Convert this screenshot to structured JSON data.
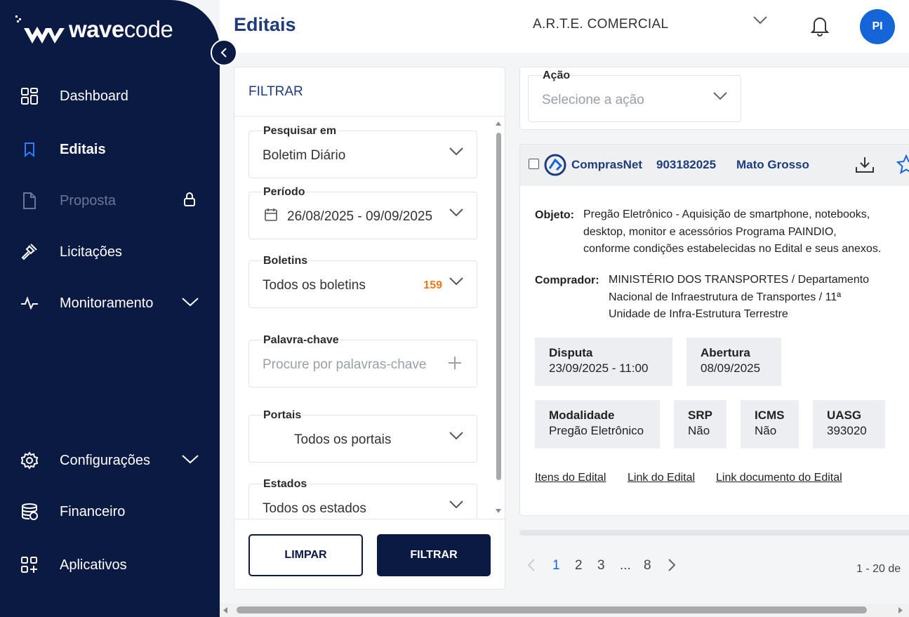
{
  "brand": {
    "name_bold": "wave",
    "name_light": "code"
  },
  "sidebar": {
    "items": [
      {
        "label": "Dashboard",
        "icon": "dashboard-grid-icon"
      },
      {
        "label": "Editais",
        "icon": "bookmark-icon"
      },
      {
        "label": "Proposta",
        "icon": "document-icon"
      },
      {
        "label": "Licitações",
        "icon": "gavel-icon"
      },
      {
        "label": "Monitoramento",
        "icon": "pulse-icon"
      },
      {
        "label": "Configurações",
        "icon": "gear-icon"
      },
      {
        "label": "Financeiro",
        "icon": "coins-stack-icon"
      },
      {
        "label": "Aplicativos",
        "icon": "apps-plus-icon"
      }
    ]
  },
  "header": {
    "title": "Editais",
    "company": "A.R.T.E. COMERCIAL",
    "avatar_initials": "PI"
  },
  "filter": {
    "title": "FILTRAR",
    "fields": {
      "pesquisar_em": {
        "label": "Pesquisar em",
        "value": "Boletim Diário"
      },
      "periodo": {
        "label": "Período",
        "value": "26/08/2025 - 09/09/2025"
      },
      "boletins": {
        "label": "Boletins",
        "value": "Todos os boletins",
        "count": "159"
      },
      "palavra_chave": {
        "label": "Palavra-chave",
        "placeholder": "Procure por palavras-chave"
      },
      "portais": {
        "label": "Portais",
        "value": "Todos os portais"
      },
      "estados": {
        "label": "Estados",
        "value": "Todos os estados"
      }
    },
    "clear_label": "LIMPAR",
    "submit_label": "FILTRAR"
  },
  "action": {
    "label": "Ação",
    "placeholder": "Selecione a ação"
  },
  "result": {
    "portal": "ComprasNet",
    "number": "903182025",
    "state": "Mato Grosso",
    "objeto_label": "Objeto:",
    "objeto_lines": [
      "Pregão Eletrônico - Aquisição de smartphone, notebooks,",
      "desktop, monitor e acessórios Programa PAINDIO,",
      "conforme condições estabelecidas no Edital e seus anexos."
    ],
    "comprador_label": "Comprador:",
    "comprador_lines": [
      "MINISTÉRIO DOS TRANSPORTES / Departamento",
      "Nacional de Infraestrutura de Transportes / 11ª",
      "Unidade de Infra-Estrutura Terrestre"
    ],
    "disputa": {
      "label": "Disputa",
      "value": "23/09/2025 - 11:00"
    },
    "abertura": {
      "label": "Abertura",
      "value": "08/09/2025"
    },
    "modalidade": {
      "label": "Modalidade",
      "value": "Pregão Eletrônico"
    },
    "srp": {
      "label": "SRP",
      "value": "Não"
    },
    "icms": {
      "label": "ICMS",
      "value": "Não"
    },
    "uasg": {
      "label": "UASG",
      "value": "393020"
    },
    "links": [
      "Itens do Edital",
      "Link do Edital",
      "Link documento do Edital"
    ]
  },
  "pagination": {
    "pages": [
      "1",
      "2",
      "3",
      "...",
      "8"
    ],
    "current": "1",
    "range": "1 - 20 de"
  }
}
